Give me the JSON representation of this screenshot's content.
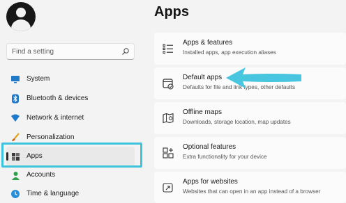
{
  "sidebar": {
    "search_placeholder": "Find a setting",
    "items": [
      {
        "label": "System",
        "icon": "monitor-icon"
      },
      {
        "label": "Bluetooth & devices",
        "icon": "bluetooth-icon"
      },
      {
        "label": "Network & internet",
        "icon": "wifi-icon"
      },
      {
        "label": "Personalization",
        "icon": "brush-icon"
      },
      {
        "label": "Apps",
        "icon": "apps-icon",
        "active": true
      },
      {
        "label": "Accounts",
        "icon": "person-icon"
      },
      {
        "label": "Time & language",
        "icon": "globe-clock-icon"
      }
    ]
  },
  "main": {
    "title": "Apps",
    "cards": [
      {
        "title": "Apps & features",
        "subtitle": "Installed apps, app execution aliases",
        "icon": "list-icon"
      },
      {
        "title": "Default apps",
        "subtitle": "Defaults for file and link types, other defaults",
        "icon": "default-apps-icon"
      },
      {
        "title": "Offline maps",
        "subtitle": "Downloads, storage location, map updates",
        "icon": "map-icon"
      },
      {
        "title": "Optional features",
        "subtitle": "Extra functionality for your device",
        "icon": "grid-plus-icon"
      },
      {
        "title": "Apps for websites",
        "subtitle": "Websites that can open in an app instead of a browser",
        "icon": "open-in-app-icon"
      }
    ]
  },
  "annotation": {
    "color": "#3ec3dd"
  }
}
